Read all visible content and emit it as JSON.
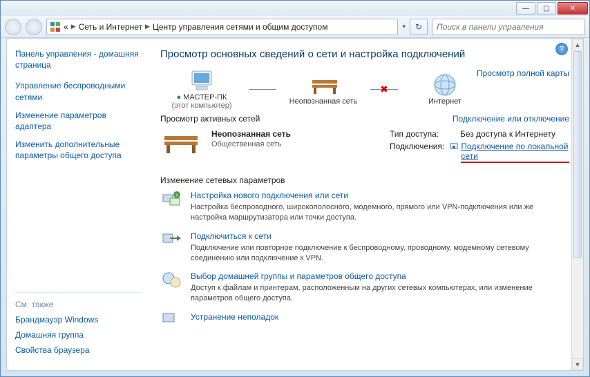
{
  "titlebar": {
    "min": "—",
    "max": "▢",
    "close": "✕"
  },
  "nav": {
    "breadcrumb_prev": "«",
    "crumb1": "Сеть и Интернет",
    "crumb2": "Центр управления сетями и общим доступом",
    "search_placeholder": "Поиск в панели управления"
  },
  "sidebar": {
    "home": "Панель управления - домашняя страница",
    "link1": "Управление беспроводными сетями",
    "link2": "Изменение параметров адаптера",
    "link3": "Изменить дополнительные параметры общего доступа",
    "seealso_hdr": "См. также",
    "see1": "Брандмауэр Windows",
    "see2": "Домашняя группа",
    "see3": "Свойства браузера"
  },
  "content": {
    "heading": "Просмотр основных сведений о сети и настройка подключений",
    "fullmap": "Просмотр полной карты",
    "node1_name": "МАСТЕР-ПК",
    "node1_sub": "(этот компьютер)",
    "node2_name": "Неопознанная сеть",
    "node3_name": "Интернет",
    "active_hdr_left": "Просмотр активных сетей",
    "active_hdr_right": "Подключение или отключение",
    "net_name": "Неопознанная сеть",
    "net_type": "Общественная сеть",
    "info_access_lbl": "Тип доступа:",
    "info_access_val": "Без доступа к Интернету",
    "info_conn_lbl": "Подключения:",
    "info_conn_val": "Подключение по локальной сети",
    "settings_hdr": "Изменение сетевых параметров",
    "s1_title": "Настройка нового подключения или сети",
    "s1_desc": "Настройка беспроводного, широкополосного, модемного, прямого или VPN-подключения или же настройка маршрутизатора или точки доступа.",
    "s2_title": "Подключиться к сети",
    "s2_desc": "Подключение или повторное подключение к беспроводному, проводному, модемному сетевому соединению или подключение к VPN.",
    "s3_title": "Выбор домашней группы и параметров общего доступа",
    "s3_desc": "Доступ к файлам и принтерам, расположенным на других сетевых компьютерах, или изменение параметров общего доступа.",
    "s4_title": "Устранение неполадок"
  }
}
